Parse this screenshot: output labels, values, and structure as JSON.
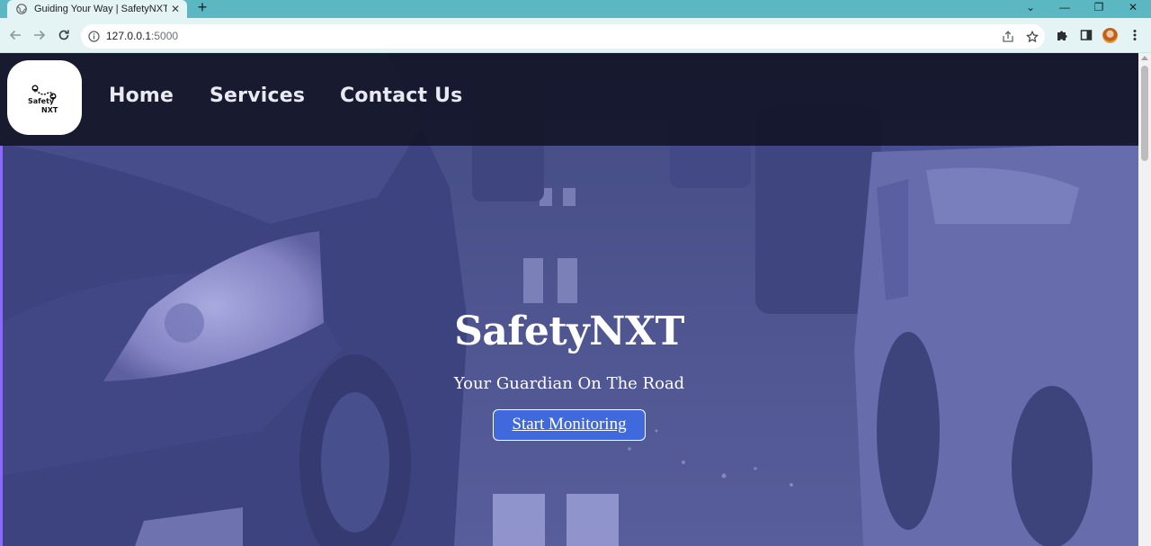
{
  "browser": {
    "tab_title": "Guiding Your Way | SafetyNXT.co",
    "tab_close": "✕",
    "new_tab": "+",
    "url_host": "127.0.0.1",
    "url_port": ":5000",
    "window_controls": {
      "dropdown": "⌄",
      "minimize": "—",
      "restore": "❐",
      "close": "✕"
    }
  },
  "site": {
    "logo": {
      "line1": "Safety",
      "line2": "NXT"
    },
    "nav": [
      {
        "label": "Home"
      },
      {
        "label": "Services"
      },
      {
        "label": "Contact Us"
      }
    ],
    "hero": {
      "title": "SafetyNXT",
      "subtitle": "Your Guardian On The Road",
      "cta_label": "Start Monitoring"
    }
  },
  "colors": {
    "tab_strip": "#5bb8c2",
    "toolbar": "#e4f3f4",
    "header_bg": "#101222",
    "hero_tint": "#5c68cd",
    "cta_bg": "#3f69dc",
    "left_accent": "#8b69ff"
  }
}
